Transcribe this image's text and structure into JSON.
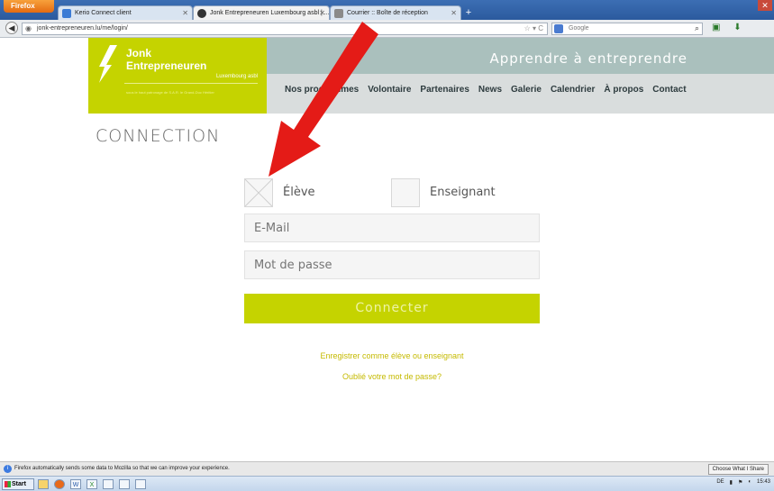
{
  "browser": {
    "firefox_button": "Firefox",
    "tabs": [
      {
        "title": "Kerio Connect client",
        "active": false
      },
      {
        "title": "Jonk Entrepreneuren Luxembourg asbl | ...",
        "active": true
      },
      {
        "title": "Courrier :: Boîte de réception",
        "active": false
      }
    ],
    "url": "jonk-entrepreneuren.lu/me/login/",
    "search_placeholder": "Google"
  },
  "site": {
    "logo_line1": "Jonk",
    "logo_line2": "Entrepreneuren",
    "logo_country": "Luxembourg asbl",
    "logo_patronage": "sous le haut patronage de S.A.R. le Grand-Duc Héritier",
    "tagline": "Apprendre à entreprendre",
    "nav": [
      "Nos programmes",
      "Volontaire",
      "Partenaires",
      "News",
      "Galerie",
      "Calendrier",
      "À propos",
      "Contact"
    ],
    "brand_color": "#c5d300"
  },
  "login": {
    "title": "CONNECTION",
    "role_student": "Élève",
    "role_teacher": "Enseignant",
    "email_placeholder": "E-Mail",
    "password_placeholder": "Mot de passe",
    "submit": "Connecter",
    "register_link": "Enregistrer comme élève ou enseignant",
    "forgot_link": "Oublié votre mot de passe?"
  },
  "notification": {
    "text": "Firefox automatically sends some data to Mozilla so that we can improve your experience.",
    "button": "Choose What I Share"
  },
  "taskbar": {
    "start": "Start",
    "language": "DE",
    "time": "15:43"
  }
}
